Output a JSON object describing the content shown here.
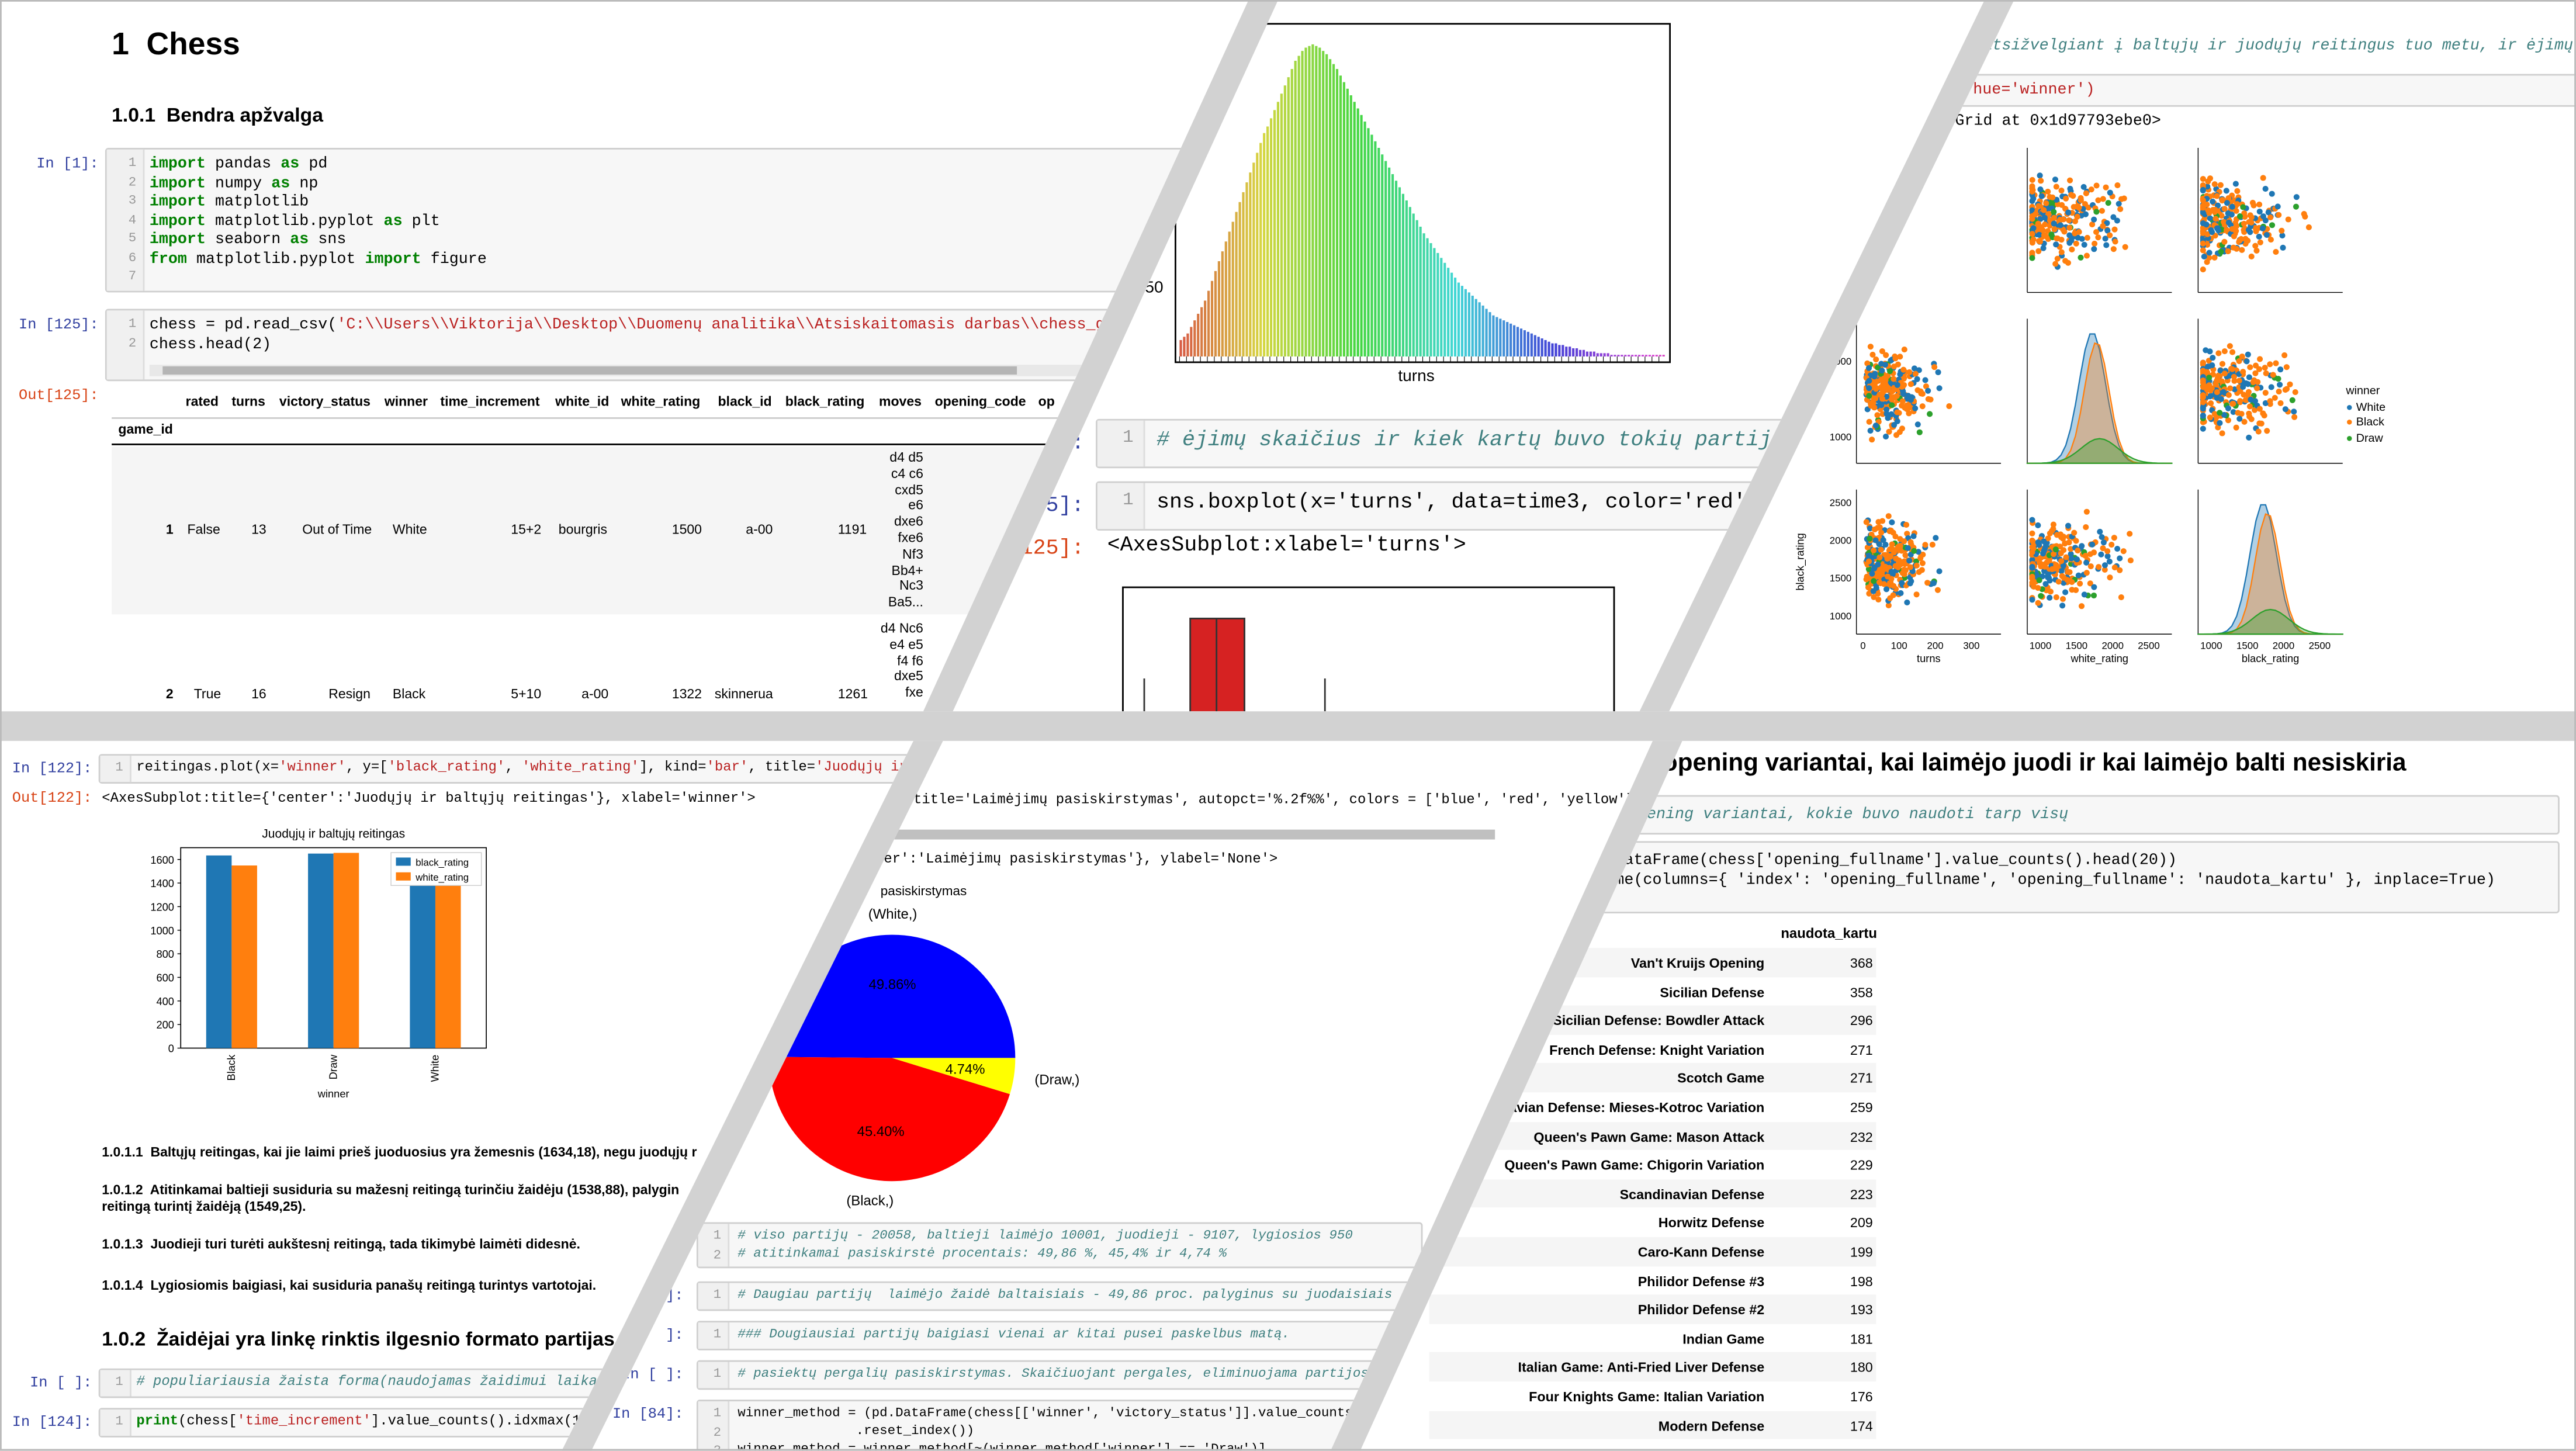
{
  "chess_panel": {
    "title": "1  Chess",
    "subtitle": "1.0.1  Bendra apžvalga",
    "cell1_prompt": "In [1]:",
    "cell1_lines": [
      "1",
      "2",
      "3",
      "4",
      "5",
      "6",
      "7"
    ],
    "cell1_code": [
      "import pandas as pd",
      "import numpy as np",
      "import matplotlib",
      "import matplotlib.pyplot as plt",
      "import seaborn as sns",
      "from matplotlib.pyplot import figure",
      ""
    ],
    "cell2_prompt": "In [125]:",
    "cell2_code": [
      "chess = pd.read_csv('C:\\\\Users\\\\Viktorija\\\\Desktop\\\\Duomenų analitika\\\\Atsiskaitomasis darbas\\\\chess_games.cs",
      "chess.head(2)"
    ],
    "out_prompt": "Out[125]:",
    "columns": [
      "rated",
      "turns",
      "victory_status",
      "winner",
      "time_increment",
      "white_id",
      "white_rating",
      "black_id",
      "black_rating",
      "moves",
      "opening_code",
      "op"
    ],
    "index_name": "game_id",
    "row1": [
      "1",
      "False",
      "13",
      "Out of Time",
      "White",
      "15+2",
      "bourgris",
      "1500",
      "a-00",
      "1191"
    ],
    "row1_moves": [
      "d4 d5",
      "c4 c6",
      "cxd5",
      "e6",
      "dxe6",
      "fxe6",
      "Nf3",
      "Bb4+",
      "Nc3",
      "Ba5..."
    ],
    "row2": [
      "2",
      "True",
      "16",
      "Resign",
      "Black",
      "5+10",
      "a-00",
      "1322",
      "skinnerua",
      "1261"
    ],
    "row2_moves": [
      "d4 Nc6",
      "e4 e5",
      "f4 f6",
      "dxe5",
      "fxe"
    ]
  },
  "hist_panel": {
    "y_tick": "50",
    "xlabel": "turns",
    "comment_prompt": "]:",
    "comment": "# ėjimų skaičius ir kiek kartų buvo tokių partijų",
    "box_prompt": "25]:",
    "box_code": "sns.boxplot(x='turns', data=time3, color='red', line",
    "box_out_prompt": "[125]:",
    "box_out": "<AxesSubplot:xlabel='turns'>"
  },
  "pair_panel": {
    "header1": "s",
    "header2": "s, atsižvelgiant į baltųjų ir juodųjų reitingus tuo metu, ir ėjimų pasiski",
    "code": "hue='winner')",
    "out": "Grid at 0x1d97793ebe0>",
    "legend_title": "winner",
    "legend": [
      "White",
      "Black",
      "Draw"
    ],
    "colors": {
      "White": "#1f77b4",
      "Black": "#ff7f0e",
      "Draw": "#2ca02c"
    },
    "xlabels": [
      "turns",
      "white_rating",
      "black_rating"
    ],
    "ylabel3": "black_rating",
    "y_ticks_row2": [
      "2000",
      "1000"
    ],
    "y_ticks_row3": [
      "2500",
      "2000",
      "1500",
      "1000"
    ],
    "x_ticks_turns": [
      "0",
      "100",
      "200",
      "300"
    ],
    "x_ticks_rating": [
      "1000",
      "1500",
      "2000",
      "2500"
    ]
  },
  "bar_panel": {
    "prompt": "In [122]:",
    "code": "reitingas.plot(x='winner', y=['black_rating', 'white_rating'], kind='bar', title='Juodųjų ir baltųjų reitingas')",
    "code_tail": "nner')).value_counts()",
    "out_prompt": "Out[122]:",
    "out": "<AxesSubplot:title={'center':'Juodųjų ir baltųjų reitingas'}, xlabel='winner'>",
    "chart_title": "Juodųjų ir baltųjų reitingas",
    "xlabel": "winner",
    "notes": [
      "1.0.1.1  Baltųjų reitingas, kai jie laimi prieš juoduosius yra žemesnis (1634,18), negu juodųjų r",
      "1.0.1.2  Atitinkamai baltieji susiduria su mažesnį reitingą turinčiu žaidėju (1538,88), palygin",
      "reitingą turintį žaidėją (1549,25).",
      "1.0.1.3  Juodieji turi turėti aukštesnį reitingą, tada tikimybė laimėti didesnė.",
      "1.0.1.4  Lygiosiomis baigiasi, kai susiduria panašų reitingą turintys vartotojai."
    ],
    "section": "1.0.2  Žaidėjai yra linkę rinktis ilgesnio formato partijas",
    "c1_prompt": "In [ ]:",
    "c1": "# populiariausia žaista forma(naudojamas žaidimui laikas).",
    "c2_prompt": "In [124]:",
    "c2": "print(chess['time_increment'].value_counts().idxmax(10))"
  },
  "pie_panel": {
    "code": "title='Laimėjimų pasiskirstymas', autopct='%.2f%%', colors = ['blue', 'red', 'yellow'], figsize",
    "out": "er':'Laimėjimų pasiskirstymas'}, ylabel='None'>",
    "chart_title": "pasiskirstymas",
    "labels": [
      "(White,)",
      "(Black,)",
      "(Draw,)"
    ],
    "pct": [
      "49.86%",
      "45.40%",
      "4.74%"
    ],
    "cm1": "# viso partijų - 20058, baltieji laimėjo 10001, juodieji - 9107, lygiosios 950",
    "cm2": "# atitinkamai pasiskirstė procentais: 49,86 %, 45,4% ir 4,74 %",
    "cm3": "# Daugiau partijų  laimėjo žaidė baltaisiais - 49,86 proc. palyginus su juodaisiais - 45,4",
    "cm4": "### Dougiausiai partijų baigiasi vienai ar kitai pusei paskelbus matą.",
    "cm5": "# pasiektų pergalių pasiskirstymas. Skaičiuojant pergales, eliminuojama partijos, kur",
    "code2": [
      "winner_method = (pd.DataFrame(chess[['winner', 'victory_status']].value_counts())",
      "               .reset_index())",
      "winner_method = winner_method[~(winner_method['winner'] == 'Draw')]"
    ],
    "p1": "In [ ]:",
    "p2": "In [84]:",
    "p3": "]:"
  },
  "open_panel": {
    "title": "opening variantai, kai laimėjo juodi ir kai laimėjo balti nesiskiria",
    "comment": "opening variantai, kokie buvo naudoti tarp visų",
    "code1": "DataFrame(chess['opening_fullname'].value_counts().head(20))",
    "code2": "me(columns={ 'index': 'opening_fullname', 'opening_fullname': 'naudota_kartu' }, inplace=True)",
    "col": "naudota_kartu",
    "rows": [
      [
        "Van't Kruijs Opening",
        "368"
      ],
      [
        "Sicilian Defense",
        "358"
      ],
      [
        "Sicilian Defense: Bowdler Attack",
        "296"
      ],
      [
        "French Defense: Knight Variation",
        "271"
      ],
      [
        "Scotch Game",
        "271"
      ],
      [
        "dinavian Defense: Mieses-Kotroc Variation",
        "259"
      ],
      [
        "Queen's Pawn Game: Mason Attack",
        "232"
      ],
      [
        "Queen's Pawn Game: Chigorin Variation",
        "229"
      ],
      [
        "Scandinavian Defense",
        "223"
      ],
      [
        "Horwitz Defense",
        "209"
      ],
      [
        "Caro-Kann Defense",
        "199"
      ],
      [
        "Philidor Defense #3",
        "198"
      ],
      [
        "Philidor Defense #2",
        "193"
      ],
      [
        "Indian Game",
        "181"
      ],
      [
        "Italian Game: Anti-Fried Liver Defense",
        "180"
      ],
      [
        "Four Knights Game: Italian Variation",
        "176"
      ],
      [
        "Modern Defense",
        "174"
      ]
    ]
  },
  "chart_data": [
    {
      "type": "bar",
      "title": "Juodųjų ir baltųjų reitingas",
      "xlabel": "winner",
      "categories": [
        "Black",
        "Draw",
        "White"
      ],
      "series": [
        {
          "name": "black_rating",
          "values": [
            1634,
            1650,
            1541
          ]
        },
        {
          "name": "white_rating",
          "values": [
            1549,
            1656,
            1634
          ]
        }
      ],
      "ylim": [
        0,
        1700
      ],
      "yticks": [
        0,
        200,
        400,
        600,
        800,
        1000,
        1200,
        1400,
        1600
      ],
      "legend": "top-right"
    },
    {
      "type": "pie",
      "title": "pasiskirstymas",
      "labels": [
        "(White,)",
        "(Black,)",
        "(Draw,)"
      ],
      "values": [
        49.86,
        45.4,
        4.74
      ],
      "colors": [
        "#0000ff",
        "#ff0000",
        "#ffff00"
      ]
    },
    {
      "type": "bar",
      "xlabel": "turns",
      "values": [
        10,
        12,
        14,
        18,
        22,
        26,
        30,
        34,
        40,
        46,
        52,
        58,
        64,
        70,
        76,
        82,
        88,
        94,
        100,
        106,
        112,
        118,
        124,
        130,
        136,
        140,
        145,
        150,
        155,
        160,
        165,
        170,
        175,
        180,
        183,
        186,
        188,
        189,
        190,
        189,
        188,
        186,
        184,
        181,
        178,
        175,
        171,
        167,
        163,
        159,
        155,
        151,
        147,
        143,
        139,
        135,
        131,
        127,
        123,
        119,
        115,
        111,
        107,
        103,
        99,
        95,
        91,
        87,
        83,
        79,
        75,
        72,
        69,
        66,
        63,
        60,
        57,
        54,
        51,
        48,
        45,
        43,
        41,
        39,
        37,
        35,
        33,
        31,
        29,
        27,
        25,
        24,
        23,
        22,
        21,
        20,
        19,
        18,
        17,
        16,
        15,
        14,
        13,
        12,
        11,
        10,
        9,
        8,
        8,
        7,
        7,
        6,
        6,
        5,
        5,
        4,
        4,
        3,
        3,
        3,
        2,
        2,
        2,
        2,
        1,
        1,
        1,
        1,
        1,
        1,
        1,
        1,
        1,
        1,
        1,
        1,
        1,
        1,
        1,
        1
      ]
    }
  ]
}
